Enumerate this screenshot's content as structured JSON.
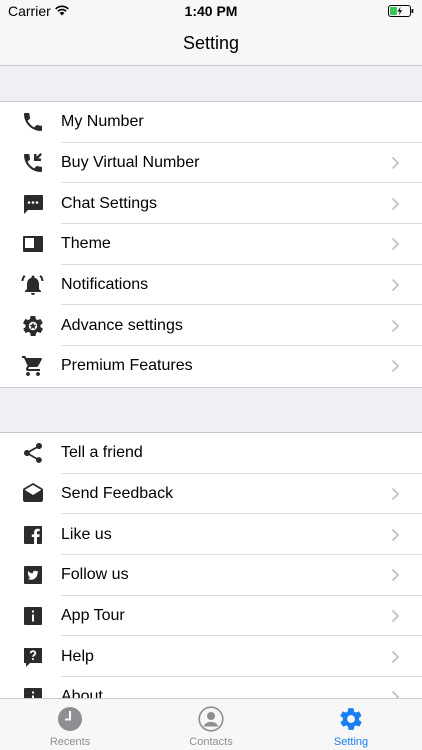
{
  "status": {
    "carrier": "Carrier",
    "time": "1:40 PM"
  },
  "nav": {
    "title": "Setting"
  },
  "group1": [
    {
      "label": "My Number",
      "icon": "phone-icon",
      "chevron": false
    },
    {
      "label": "Buy Virtual Number",
      "icon": "phone-forward-icon",
      "chevron": true
    },
    {
      "label": "Chat Settings",
      "icon": "chat-bubble-icon",
      "chevron": true
    },
    {
      "label": "Theme",
      "icon": "theme-icon",
      "chevron": true
    },
    {
      "label": "Notifications",
      "icon": "bell-icon",
      "chevron": true
    },
    {
      "label": "Advance settings",
      "icon": "gear-icon",
      "chevron": true
    },
    {
      "label": "Premium Features",
      "icon": "cart-icon",
      "chevron": true
    }
  ],
  "group2": [
    {
      "label": "Tell a friend",
      "icon": "share-icon",
      "chevron": false
    },
    {
      "label": "Send Feedback",
      "icon": "mail-icon",
      "chevron": true
    },
    {
      "label": "Like us",
      "icon": "facebook-icon",
      "chevron": true
    },
    {
      "label": "Follow us",
      "icon": "twitter-icon",
      "chevron": true
    },
    {
      "label": "App Tour",
      "icon": "info-icon",
      "chevron": true
    },
    {
      "label": "Help",
      "icon": "help-icon",
      "chevron": true
    },
    {
      "label": "About",
      "icon": "about-icon",
      "chevron": true
    }
  ],
  "tabs": [
    {
      "label": "Recents",
      "icon": "clock-icon",
      "active": false
    },
    {
      "label": "Contacts",
      "icon": "person-icon",
      "active": false
    },
    {
      "label": "Setting",
      "icon": "gear-icon",
      "active": true
    }
  ],
  "colors": {
    "accent": "#1a7ef2",
    "icon": "#2b2b2b",
    "chevron": "#c7c7cc",
    "inactive": "#8e8e93"
  }
}
